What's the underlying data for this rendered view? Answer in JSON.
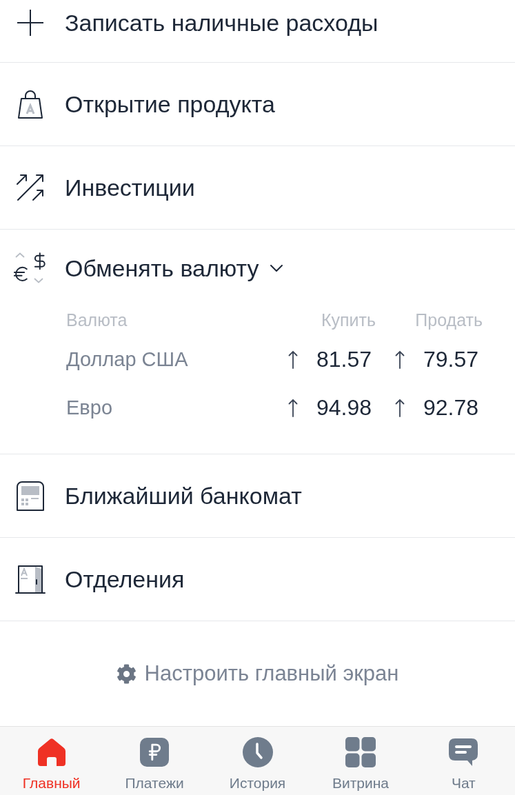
{
  "menu": [
    {
      "kind": "plus",
      "label": "Записать наличные расходы"
    },
    {
      "kind": "bag",
      "label": "Открытие продукта"
    },
    {
      "kind": "growth",
      "label": "Инвестиции"
    },
    {
      "kind": "exchange",
      "label": "Обменять валюту",
      "expanded": true,
      "table": {
        "columns": [
          "Валюта",
          "Купить",
          "Продать"
        ],
        "rows": [
          {
            "currency": "Доллар США",
            "buy": "81.57",
            "sell": "79.57"
          },
          {
            "currency": "Евро",
            "buy": "94.98",
            "sell": "92.78"
          }
        ]
      }
    },
    {
      "kind": "atm",
      "label": "Ближайший банкомат"
    },
    {
      "kind": "branch",
      "label": "Отделения"
    }
  ],
  "settings_link": {
    "label": "Настроить главный экран"
  },
  "tab_bar": [
    {
      "kind": "home",
      "label": "Главный",
      "selected": true
    },
    {
      "kind": "ruble",
      "label": "Платежи",
      "selected": false
    },
    {
      "kind": "clock",
      "label": "История",
      "selected": false
    },
    {
      "kind": "grid",
      "label": "Витрина",
      "selected": false
    },
    {
      "kind": "chat",
      "label": "Чат",
      "selected": false
    }
  ]
}
